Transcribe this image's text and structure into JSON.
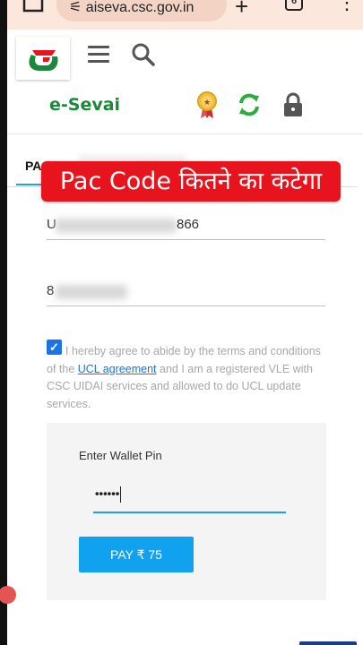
{
  "browser": {
    "url": "aiseva.csc.gov.in",
    "tab_count": "6"
  },
  "header": {
    "brand": "e-Sevai"
  },
  "tabs": {
    "active_label": "PAC"
  },
  "banner": {
    "text": "Pac Code कितने का कटेगा"
  },
  "form": {
    "ucl_id_prefix": "U",
    "ucl_id_suffix": "866",
    "mobile_prefix": "8"
  },
  "consent": {
    "text_before_link": "I hereby agree to abide by the terms and conditions of the ",
    "link_text": "UCL agreement",
    "text_after_link": " and I am a registered VLE with CSC UIDAI services and allowed to do UCL update services.",
    "checked": true
  },
  "wallet": {
    "label": "Enter Wallet Pin",
    "pin_value": "••••••",
    "pay_button": "PAY ₹ 75"
  },
  "colors": {
    "accent": "#10a2ef",
    "brand_green": "#1a8a3a",
    "banner_red": "#e8141d"
  }
}
